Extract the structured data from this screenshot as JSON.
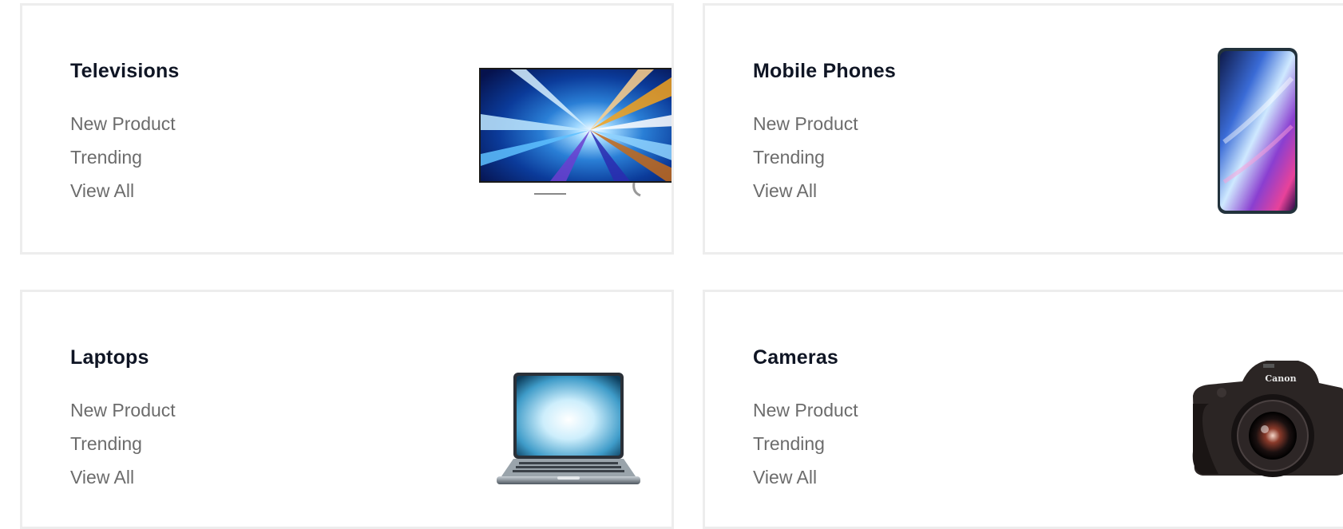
{
  "categories": [
    {
      "title": "Televisions",
      "links": [
        "New Product",
        "Trending",
        "View All"
      ],
      "image": "television-icon"
    },
    {
      "title": "Mobile Phones",
      "links": [
        "New Product",
        "Trending",
        "View All"
      ],
      "image": "mobile-phone-icon"
    },
    {
      "title": "Laptops",
      "links": [
        "New Product",
        "Trending",
        "View All"
      ],
      "image": "laptop-icon"
    },
    {
      "title": "Cameras",
      "links": [
        "New Product",
        "Trending",
        "View All"
      ],
      "image": "camera-icon",
      "brand": "Canon"
    }
  ]
}
